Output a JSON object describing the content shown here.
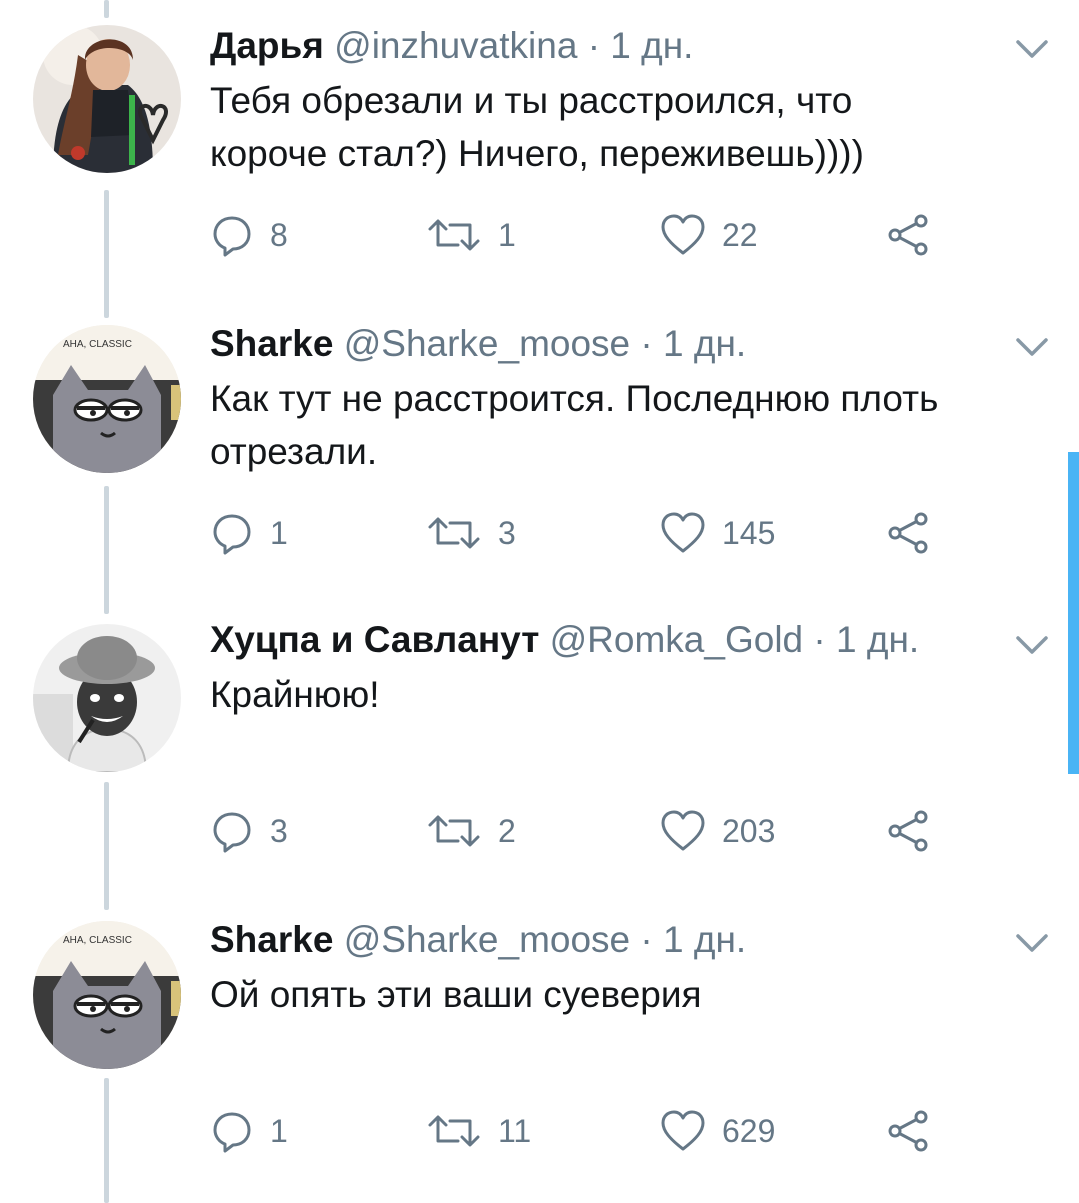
{
  "tweets": [
    {
      "name": "Дарья",
      "handle": "@inzhuvatkina",
      "sep": "·",
      "time": "1 дн.",
      "text": "Тебя обрезали и ты расстроился, что\nкороче стал?) Ничего, переживешь))))",
      "replies": "8",
      "retweets": "1",
      "likes": "22",
      "avatar": "woman-with-heart"
    },
    {
      "name": "Sharke",
      "handle": "@Sharke_moose",
      "sep": "·",
      "time": "1 дн.",
      "text": "Как тут не расстроится. Последнюю плоть\nотрезали.",
      "replies": "1",
      "retweets": "3",
      "likes": "145",
      "avatar": "cartoon-cat",
      "avatar_caption": "AHA, CLASSIC"
    },
    {
      "name": "Хуцпа и Савланут",
      "handle": "@Romka_Gold",
      "sep": "·",
      "time": "1 дн.",
      "text": "Крайнюю!",
      "replies": "3",
      "retweets": "2",
      "likes": "203",
      "avatar": "man-in-hat"
    },
    {
      "name": "Sharke",
      "handle": "@Sharke_moose",
      "sep": "·",
      "time": "1 дн.",
      "text": "Ой опять эти ваши суеверия",
      "replies": "1",
      "retweets": "11",
      "likes": "629",
      "avatar": "cartoon-cat",
      "avatar_caption": "AHA, CLASSIC"
    }
  ],
  "colors": {
    "text": "#14171a",
    "muted": "#657786",
    "thread_line": "#ccd6dd",
    "accent": "#1da1f2"
  },
  "icons": {
    "reply": "speech-bubble-icon",
    "retweet": "retweet-icon",
    "like": "heart-icon",
    "share": "share-icon",
    "menu": "chevron-down-icon"
  }
}
